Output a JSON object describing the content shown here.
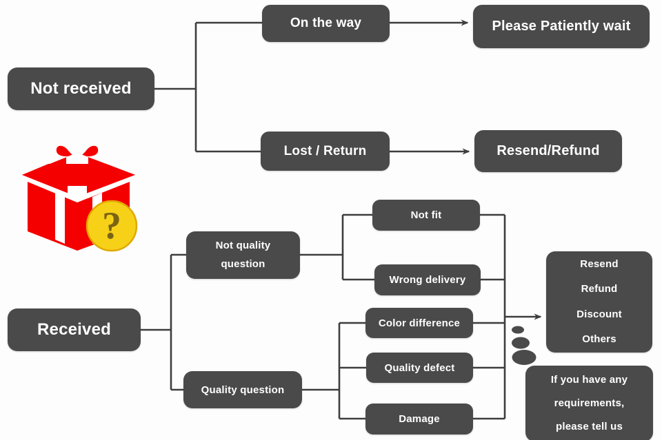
{
  "diagram": {
    "title": "Order problem handling flowchart",
    "theme": {
      "node_fill": "#4a4a4a",
      "node_text": "#ffffff",
      "wire_color": "#3d3d3d",
      "background": "#fdfdfd",
      "gift_red": "#f50000",
      "gift_ribbon": "#ffffff",
      "badge_yellow": "#f7d117",
      "badge_mark": "#7a6414"
    }
  },
  "nodes": {
    "not_received": "Not received",
    "received": "Received",
    "on_the_way": "On the way",
    "lost_return": "Lost / Return",
    "please_wait": "Please Patiently wait",
    "resend_refund": "Resend/Refund",
    "not_quality_line1": "Not quality",
    "not_quality_line2": "question",
    "quality_question": "Quality question",
    "not_fit": "Not fit",
    "wrong_delivery": "Wrong delivery",
    "color_difference": "Color difference",
    "quality_defect": "Quality defect",
    "damage": "Damage",
    "outcome_1": "Resend",
    "outcome_2": "Refund",
    "outcome_3": "Discount",
    "outcome_4": "Others",
    "tell_us_line1": "If you have any",
    "tell_us_line2": "requirements,",
    "tell_us_line3": "please tell us"
  },
  "icons": {
    "gift_box": "gift-box-icon",
    "question_badge": "question-mark-badge-icon",
    "arrow_wait": "arrow-right-icon",
    "arrow_refund": "arrow-right-icon",
    "arrow_outcomes": "arrow-right-icon",
    "speech_trail": "speech-bubble-trail-icon"
  },
  "flow": {
    "branches_not_received": [
      "On the way",
      "Lost / Return"
    ],
    "branches_received": [
      "Not quality question",
      "Quality question"
    ],
    "branches_not_quality": [
      "Not fit",
      "Wrong delivery"
    ],
    "branches_quality": [
      "Color difference",
      "Quality defect",
      "Damage"
    ],
    "outcomes": [
      "Resend",
      "Refund",
      "Discount",
      "Others"
    ]
  }
}
